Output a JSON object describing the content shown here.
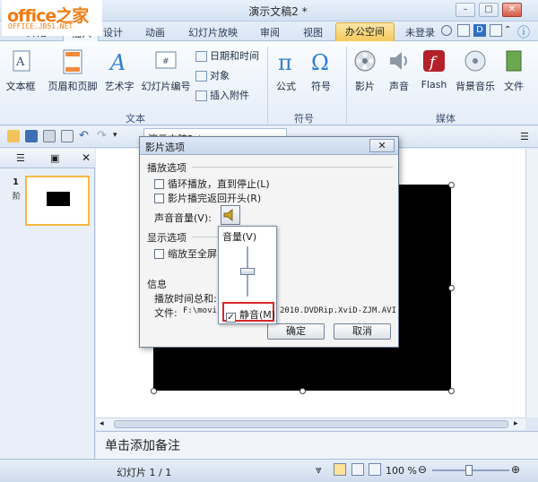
{
  "window": {
    "title": "演示文稿2 *",
    "logo_text": "office之家",
    "logo_url": "OFFICE.JB51.NET"
  },
  "tabs": [
    "开始",
    "插入",
    "设计",
    "动画",
    "幻灯片放映",
    "审阅",
    "视图",
    "办公空间"
  ],
  "account": "未登录",
  "ribbon": {
    "text_group": {
      "label": "文本",
      "items": [
        "文本框",
        "页眉和页脚",
        "艺术字",
        "幻灯片编号"
      ],
      "small": [
        "日期和时间",
        "对象",
        "插入附件"
      ]
    },
    "symbol_group": {
      "label": "符号",
      "items": [
        "公式",
        "符号"
      ]
    },
    "media_group": {
      "label": "媒体",
      "items": [
        "影片",
        "声音",
        "Flash",
        "背景音乐",
        "文件"
      ]
    }
  },
  "doc_tab": "演示文稿2 *",
  "slide_panel": {
    "num": "1",
    "sub": "阶"
  },
  "dialog": {
    "title": "影片选项",
    "play_section": "播放选项",
    "loop": "循环播放，直到停止(L)",
    "rewind": "影片播完返回开头(R)",
    "volume_label": "声音音量(V):",
    "display_section": "显示选项",
    "fullscreen": "缩放至全屏",
    "info_section": "信息",
    "total_time": "播放时间总和:",
    "file_label": "文件:",
    "file_path_start": "F:\\movi",
    "file_path_end": "2010.DVDRip.XviD-ZJM.AVI",
    "ok": "确定",
    "cancel": "取消"
  },
  "volume_popup": {
    "title": "音量(V)",
    "mute": "静音(M)",
    "level": 0.5
  },
  "notes_placeholder": "单击添加备注",
  "status": {
    "slide_info": "幻灯片 1 / 1",
    "zoom": "100 %"
  },
  "colors": {
    "accent_office_tab": "#f5c95a",
    "mute_highlight": "#d6262a",
    "logo": "#f07c12"
  }
}
